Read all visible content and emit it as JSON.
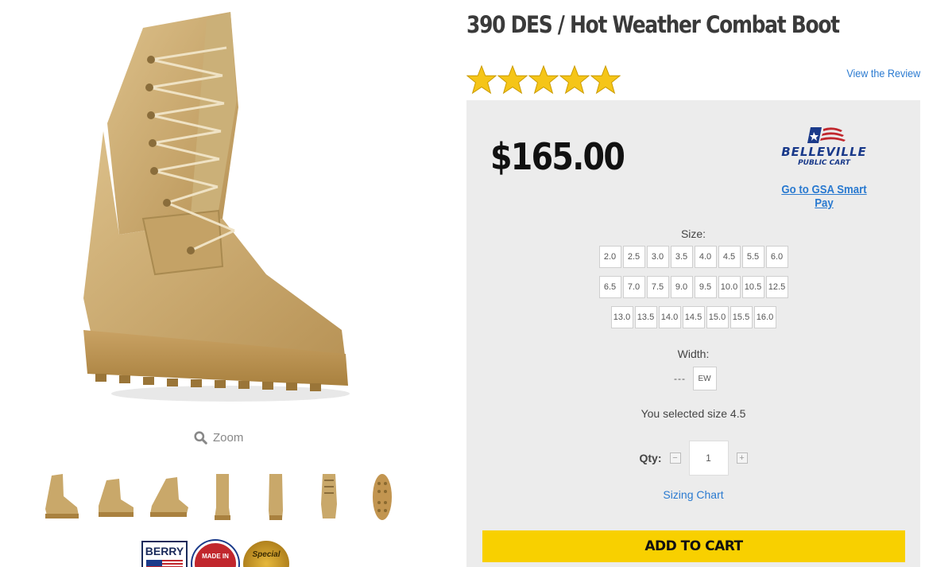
{
  "product": {
    "title": "390 DES / Hot Weather Combat Boot",
    "rating": 5,
    "rating_max": 5,
    "review_link": "View the Review",
    "price": "$165.00"
  },
  "gallery": {
    "zoom_label": "Zoom",
    "thumbnail_count": 7,
    "badges": {
      "berry": "BERRY",
      "made_in": "MADE IN",
      "special": "Special"
    }
  },
  "belleville": {
    "brand": "BELLEVILLE",
    "sub": "PUBLIC CART",
    "gsa_link": "Go to GSA Smart Pay"
  },
  "size": {
    "label": "Size:",
    "rows": [
      [
        "2.0",
        "2.5",
        "3.0",
        "3.5",
        "4.0",
        "4.5",
        "5.5",
        "6.0"
      ],
      [
        "6.5",
        "7.0",
        "7.5",
        "9.0",
        "9.5",
        "10.0",
        "10.5",
        "12.5"
      ],
      [
        "13.0",
        "13.5",
        "14.0",
        "14.5",
        "15.0",
        "15.5",
        "16.0"
      ]
    ]
  },
  "width": {
    "label": "Width:",
    "placeholder": "---",
    "option": "EW"
  },
  "selection_text": "You selected size 4.5",
  "qty": {
    "label": "Qty:",
    "value": "1",
    "minus": "−",
    "plus": "+"
  },
  "sizing_chart": "Sizing Chart",
  "add_to_cart": "ADD TO CART",
  "colors": {
    "accent_yellow": "#f8d000",
    "link_blue": "#2a7ad0",
    "boot_tan": "#c9a86a",
    "star_gold": "#f5c518"
  }
}
